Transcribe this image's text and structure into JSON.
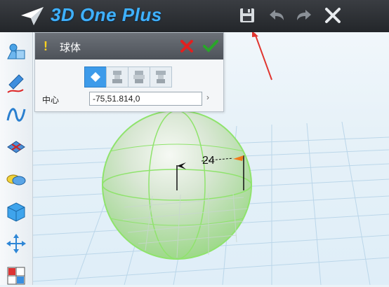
{
  "app": {
    "title": "3D One Plus"
  },
  "titlebar": {
    "buttons": [
      {
        "name": "save",
        "icon": "floppy-disk-icon"
      },
      {
        "name": "undo",
        "icon": "undo-arrow-icon"
      },
      {
        "name": "redo",
        "icon": "redo-arrow-icon"
      },
      {
        "name": "close",
        "icon": "close-x-icon"
      }
    ]
  },
  "left_toolbar": {
    "items": [
      {
        "icon": "basic-solid-icon"
      },
      {
        "icon": "sketch-pencil-icon"
      },
      {
        "icon": "curve-icon"
      },
      {
        "icon": "modify-surface-icon"
      },
      {
        "icon": "combine-icon"
      },
      {
        "icon": "cube-icon"
      },
      {
        "icon": "move-arrows-icon"
      },
      {
        "icon": "array-grid-icon"
      }
    ]
  },
  "panel": {
    "warning": "!",
    "title": "球体",
    "center_label": "中心",
    "center_value": "-75,51.814,0",
    "expand": "›"
  },
  "viewport": {
    "radius_label": "24"
  },
  "colors": {
    "accent": "#3fb1ff",
    "panel_header": "#5b6067",
    "sphere_edge": "#7fe05a",
    "cancel": "#e02020",
    "ok": "#2aa52a",
    "annotation_arrow": "#e0352f"
  }
}
